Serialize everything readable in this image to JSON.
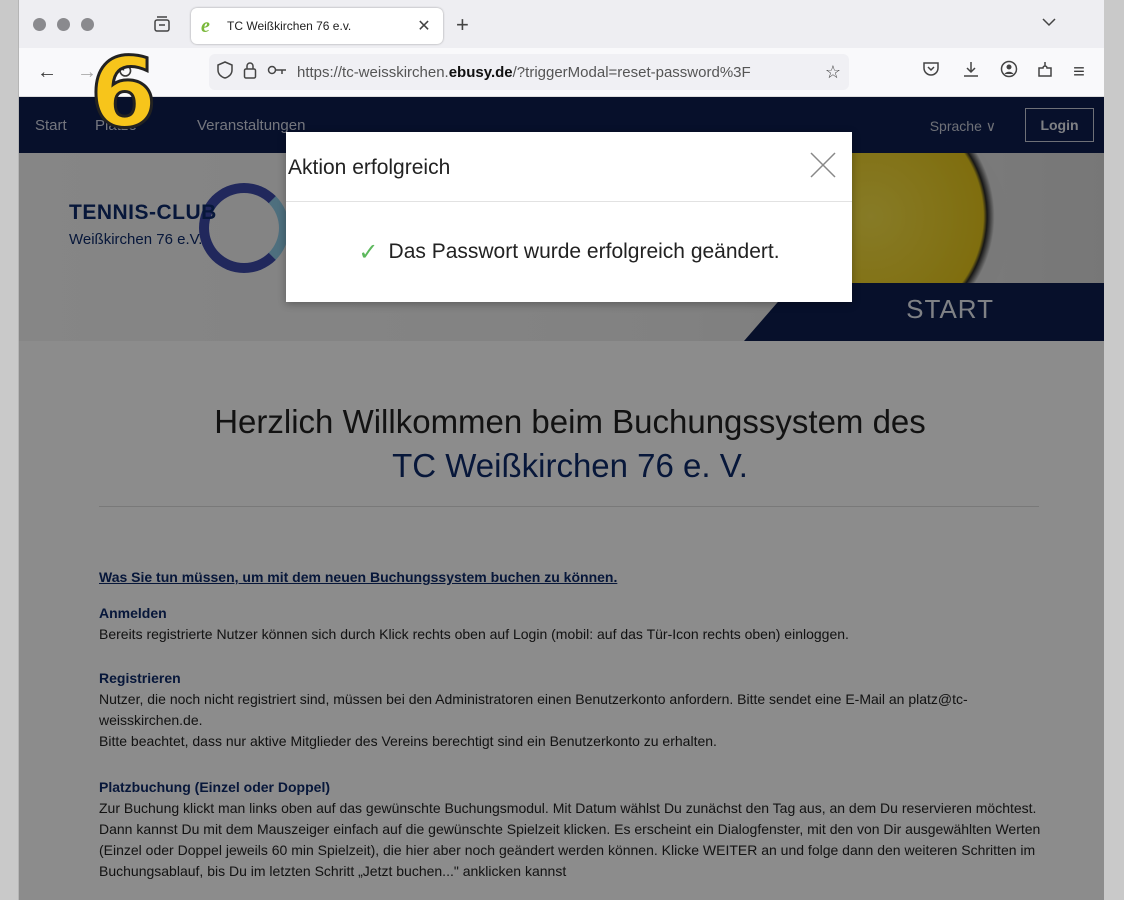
{
  "browser": {
    "tab": {
      "favicon": "e",
      "title": "TC Weißkirchen 76 e.v."
    },
    "url_prefix": "https://tc-weisskirchen.",
    "url_domain": "ebusy.de",
    "url_suffix": "/?triggerModal=reset-password%3F"
  },
  "site": {
    "nav": {
      "start": "Start",
      "plaetze": "Plätze",
      "events": "Veranstaltungen",
      "language": "Sprache ∨",
      "login": "Login"
    },
    "logo": {
      "title": "TENNIS-CLUB",
      "subtitle": "Weißkirchen 76 e.V."
    },
    "hero_label": "START",
    "heading_line1": "Herzlich Willkommen beim Buchungssystem des",
    "heading_line2": "TC Weißkirchen 76  e. V.",
    "intro_link": "Was Sie tun müssen, um mit dem neuen Buchungssystem buchen zu können.",
    "sections": [
      {
        "title": "Anmelden",
        "text": "Bereits registrierte Nutzer können sich durch Klick rechts oben auf Login (mobil: auf das Tür-Icon rechts oben) einloggen."
      },
      {
        "title": "Registrieren",
        "text": "Nutzer, die noch nicht registriert sind, müssen bei den Administratoren einen Benutzerkonto anfordern. Bitte sendet eine E-Mail an platz@tc-weisskirchen.de.",
        "text2": "Bitte beachtet, dass nur aktive Mitglieder des Vereins berechtigt sind ein Benutzerkonto zu erhalten."
      },
      {
        "title": "Platzbuchung (Einzel oder Doppel)",
        "text": "Zur Buchung klickt man links oben auf das gewünschte Buchungsmodul. Mit Datum wählst Du zunächst den Tag aus, an dem Du reservieren möchtest. Dann kannst Du mit dem Mauszeiger einfach auf die gewünschte Spielzeit klicken. Es erscheint ein Dialogfenster, mit den von Dir ausgewählten Werten (Einzel oder Doppel jeweils 60 min Spielzeit), die hier aber noch geändert werden können. Klicke WEITER an und folge dann den weiteren  Schritten im Buchungsablauf, bis Du im letzten Schritt „Jetzt buchen...\" anklicken kannst"
      }
    ]
  },
  "modal": {
    "title": "Aktion erfolgreich",
    "message": "Das Passwort wurde erfolgreich geändert."
  },
  "step_badge": "6"
}
